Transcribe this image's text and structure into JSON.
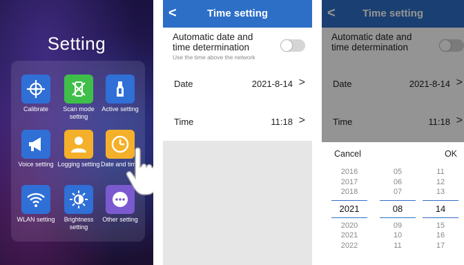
{
  "home": {
    "title": "Setting",
    "apps": [
      {
        "label": "Calibrate",
        "icon": "calibrate-icon",
        "color": "#2f6fd6"
      },
      {
        "label": "Scan mode setting",
        "icon": "scan-mode-icon",
        "color": "#3fbf4a"
      },
      {
        "label": "Active setting",
        "icon": "active-icon",
        "color": "#2f6fd6"
      },
      {
        "label": "Voice setting",
        "icon": "megaphone-icon",
        "color": "#2f6fd6"
      },
      {
        "label": "Logging setting",
        "icon": "user-icon",
        "color": "#f4b02a"
      },
      {
        "label": "Date and time",
        "icon": "clock-icon",
        "color": "#f4b02a"
      },
      {
        "label": "WLAN setting",
        "icon": "wifi-icon",
        "color": "#2f6fd6"
      },
      {
        "label": "Brightness setting",
        "icon": "brightness-icon",
        "color": "#2f6fd6"
      },
      {
        "label": "Other setting",
        "icon": "more-icon",
        "color": "#7b5ad0"
      }
    ]
  },
  "time_setting": {
    "back": "<",
    "title": "Time setting",
    "auto_label_line1": "Automatic date and",
    "auto_label_line2": "time determination",
    "auto_hint": "Use the time above the network",
    "auto_enabled": false,
    "date_label": "Date",
    "date_value": "2021-8-14",
    "time_label": "Time",
    "time_value": "11:18",
    "chevron": ">"
  },
  "picker": {
    "cancel": "Cancel",
    "ok": "OK",
    "years": [
      "2016",
      "2017",
      "2018",
      "2021",
      "2020",
      "2021",
      "2022"
    ],
    "months": [
      "05",
      "06",
      "07",
      "08",
      "09",
      "10",
      "11"
    ],
    "days": [
      "11",
      "12",
      "13",
      "14",
      "15",
      "16",
      "17"
    ]
  },
  "colors": {
    "header_blue": "#2d6fc7",
    "toggle_off": "#d5d5d5"
  }
}
